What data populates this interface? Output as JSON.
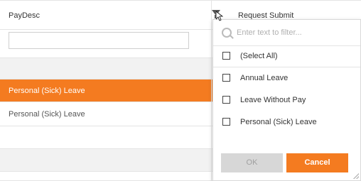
{
  "grid": {
    "columns": [
      "PayDesc",
      "Request Submit"
    ],
    "rows": [
      {
        "text": "Personal (Sick) Leave",
        "selected": true
      },
      {
        "text": "Personal (Sick) Leave",
        "selected": false
      }
    ]
  },
  "filter_popup": {
    "placeholder": "Enter text to filter...",
    "select_all": "(Select All)",
    "items": [
      "Annual Leave",
      "Leave Without Pay",
      "Personal (Sick) Leave"
    ],
    "ok_label": "OK",
    "cancel_label": "Cancel"
  },
  "colors": {
    "accent": "#f47b20",
    "group_row": "#f2f2f2",
    "disabled_btn": "#d7d7d7"
  },
  "icons": {
    "filter": "funnel-icon",
    "search": "search-icon",
    "cursor": "mouse-pointer-icon",
    "resize": "resize-grip-icon"
  }
}
